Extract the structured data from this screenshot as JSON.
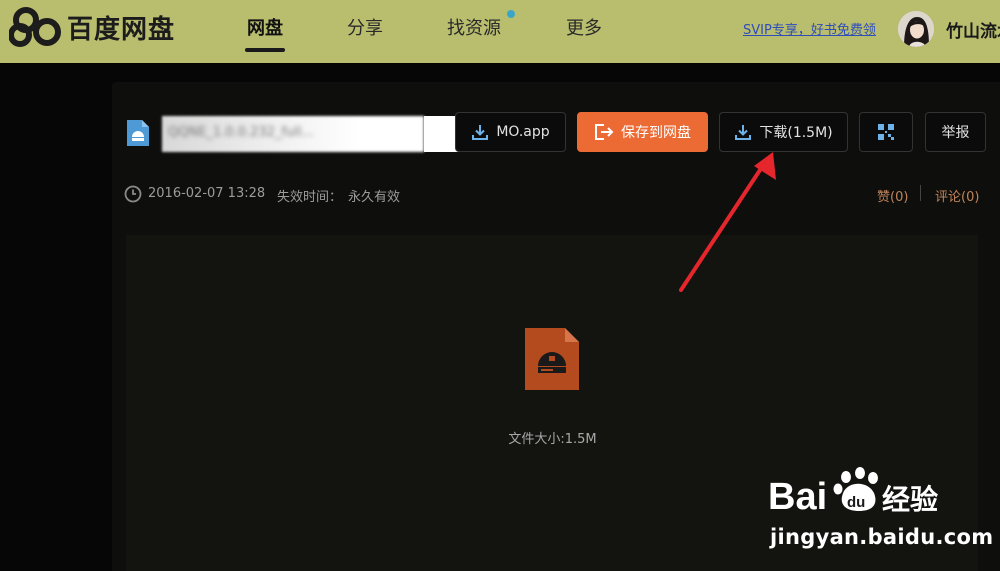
{
  "header": {
    "logo_text": "百度网盘",
    "nav": [
      {
        "label": "网盘",
        "active": true
      },
      {
        "label": "分享",
        "active": false
      },
      {
        "label": "找资源",
        "active": false,
        "has_dot": true
      },
      {
        "label": "更多",
        "active": false
      }
    ],
    "svip_link": "SVIP专享，好书免费领",
    "user_name": "竹山流水",
    "avatar_icon": "user-avatar"
  },
  "file": {
    "name_visible": "QQNE_1.0.0.232_full...",
    "icon": "disk-image-icon"
  },
  "actions": {
    "mo_app": "MO.app",
    "save": "保存到网盘",
    "download": "下载(1.5M)",
    "qr_icon": "qr-code-icon",
    "report": "举报"
  },
  "meta": {
    "date": "2016-02-07 13:28",
    "expire_label": "失效时间：",
    "expire_value": "永久有效",
    "like": "赞(0)",
    "comment": "评论(0)"
  },
  "preview": {
    "size_text": "文件大小:1.5M"
  },
  "watermark": {
    "brand": "Bai du 经验",
    "url": "jingyan.baidu.com"
  },
  "colors": {
    "header_bg": "#b9bd6e",
    "save_button": "#ec6b34",
    "annotation_arrow": "#e5262c",
    "link": "#2e4dbb",
    "meta_link": "#c1845a"
  }
}
